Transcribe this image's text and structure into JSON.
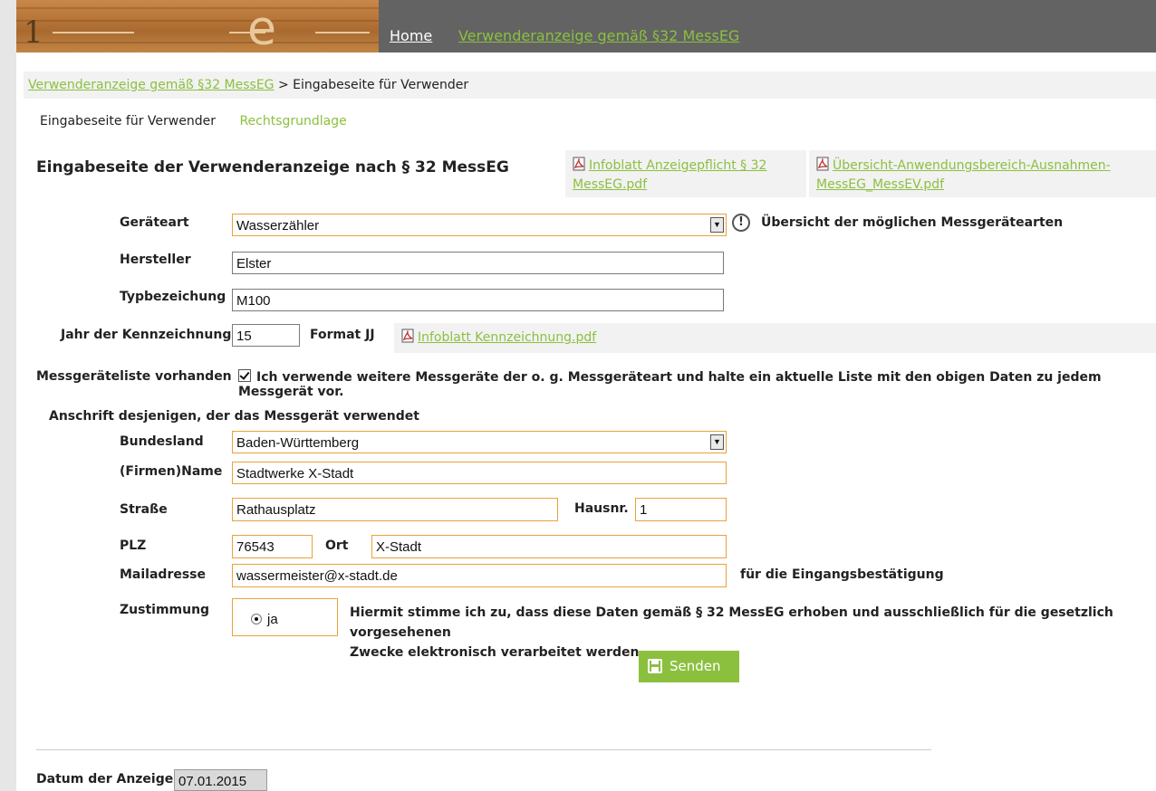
{
  "header": {
    "logo_number": "1",
    "logo_letter": "e",
    "nav_home": "Home",
    "nav_verwenderanzeige": "Verwenderanzeige gemäß §32 MessEG"
  },
  "breadcrumb": {
    "link": "Verwenderanzeige gemäß §32 MessEG",
    "separator": ">",
    "current": "Eingabeseite für Verwender"
  },
  "tabs": {
    "active": "Eingabeseite für Verwender",
    "other": "Rechtsgrundlage"
  },
  "page_title": "Eingabeseite der Verwenderanzeige nach § 32 MessEG",
  "pdf_links": {
    "infoblatt_line1": "Infoblatt Anzeigepflicht § 32",
    "infoblatt_line2": "MessEG.pdf",
    "uebersicht_line1": "Übersicht-Anwendungsbereich-Ausnahmen-",
    "uebersicht_line2": "MessEG_MessEV.pdf",
    "kennzeichnung": "Infoblatt Kennzeichnung.pdf"
  },
  "form": {
    "geraeteart_label": "Geräteart",
    "geraeteart_value": "Wasserzähler",
    "geraeteart_hint": "Übersicht der möglichen Messgerätearten",
    "hersteller_label": "Hersteller",
    "hersteller_value": "Elster",
    "typ_label": "Typbezeichung",
    "typ_value": "M100",
    "jahr_label": "Jahr der Kennzeichnung",
    "jahr_value": "15",
    "jahr_format": "Format JJ",
    "liste_label": "Messgeräteliste vorhanden",
    "liste_text": "Ich verwende weitere Messgeräte der o. g. Messgeräteart und halte ein aktuelle Liste mit den obigen Daten zu jedem Messgerät vor.",
    "liste_checked": true,
    "anschrift_heading": "Anschrift desjenigen, der das Messgerät verwendet",
    "bundesland_label": "Bundesland",
    "bundesland_value": "Baden-Württemberg",
    "name_label": "(Firmen)Name",
    "name_value": "Stadtwerke X-Stadt",
    "strasse_label": "Straße",
    "strasse_value": "Rathausplatz",
    "hausnr_label": "Hausnr.",
    "hausnr_value": "1",
    "plz_label": "PLZ",
    "plz_value": "76543",
    "ort_label": "Ort",
    "ort_value": "X-Stadt",
    "mail_label": "Mailadresse",
    "mail_value": "wassermeister@x-stadt.de",
    "mail_hint": "für die Eingangsbestätigung",
    "zustimmung_label": "Zustimmung",
    "zustimmung_option": "ja",
    "zustimmung_text_line1": "Hiermit stimme ich zu, dass diese Daten gemäß § 32 MessEG erhoben und ausschließlich für die gesetzlich vorgesehenen",
    "zustimmung_text_line2": "Zwecke elektronisch verarbeitet werden.",
    "submit_label": "Senden"
  },
  "footer": {
    "datum_label": "Datum der Anzeige",
    "datum_value": "07.01.2015"
  },
  "colors": {
    "accent_green": "#8bc03f",
    "header_grey": "#636363",
    "input_orange": "#e8a23a"
  },
  "icons": [
    "pdf-icon",
    "warning-icon",
    "save-disk-icon",
    "chevron-down-icon"
  ]
}
